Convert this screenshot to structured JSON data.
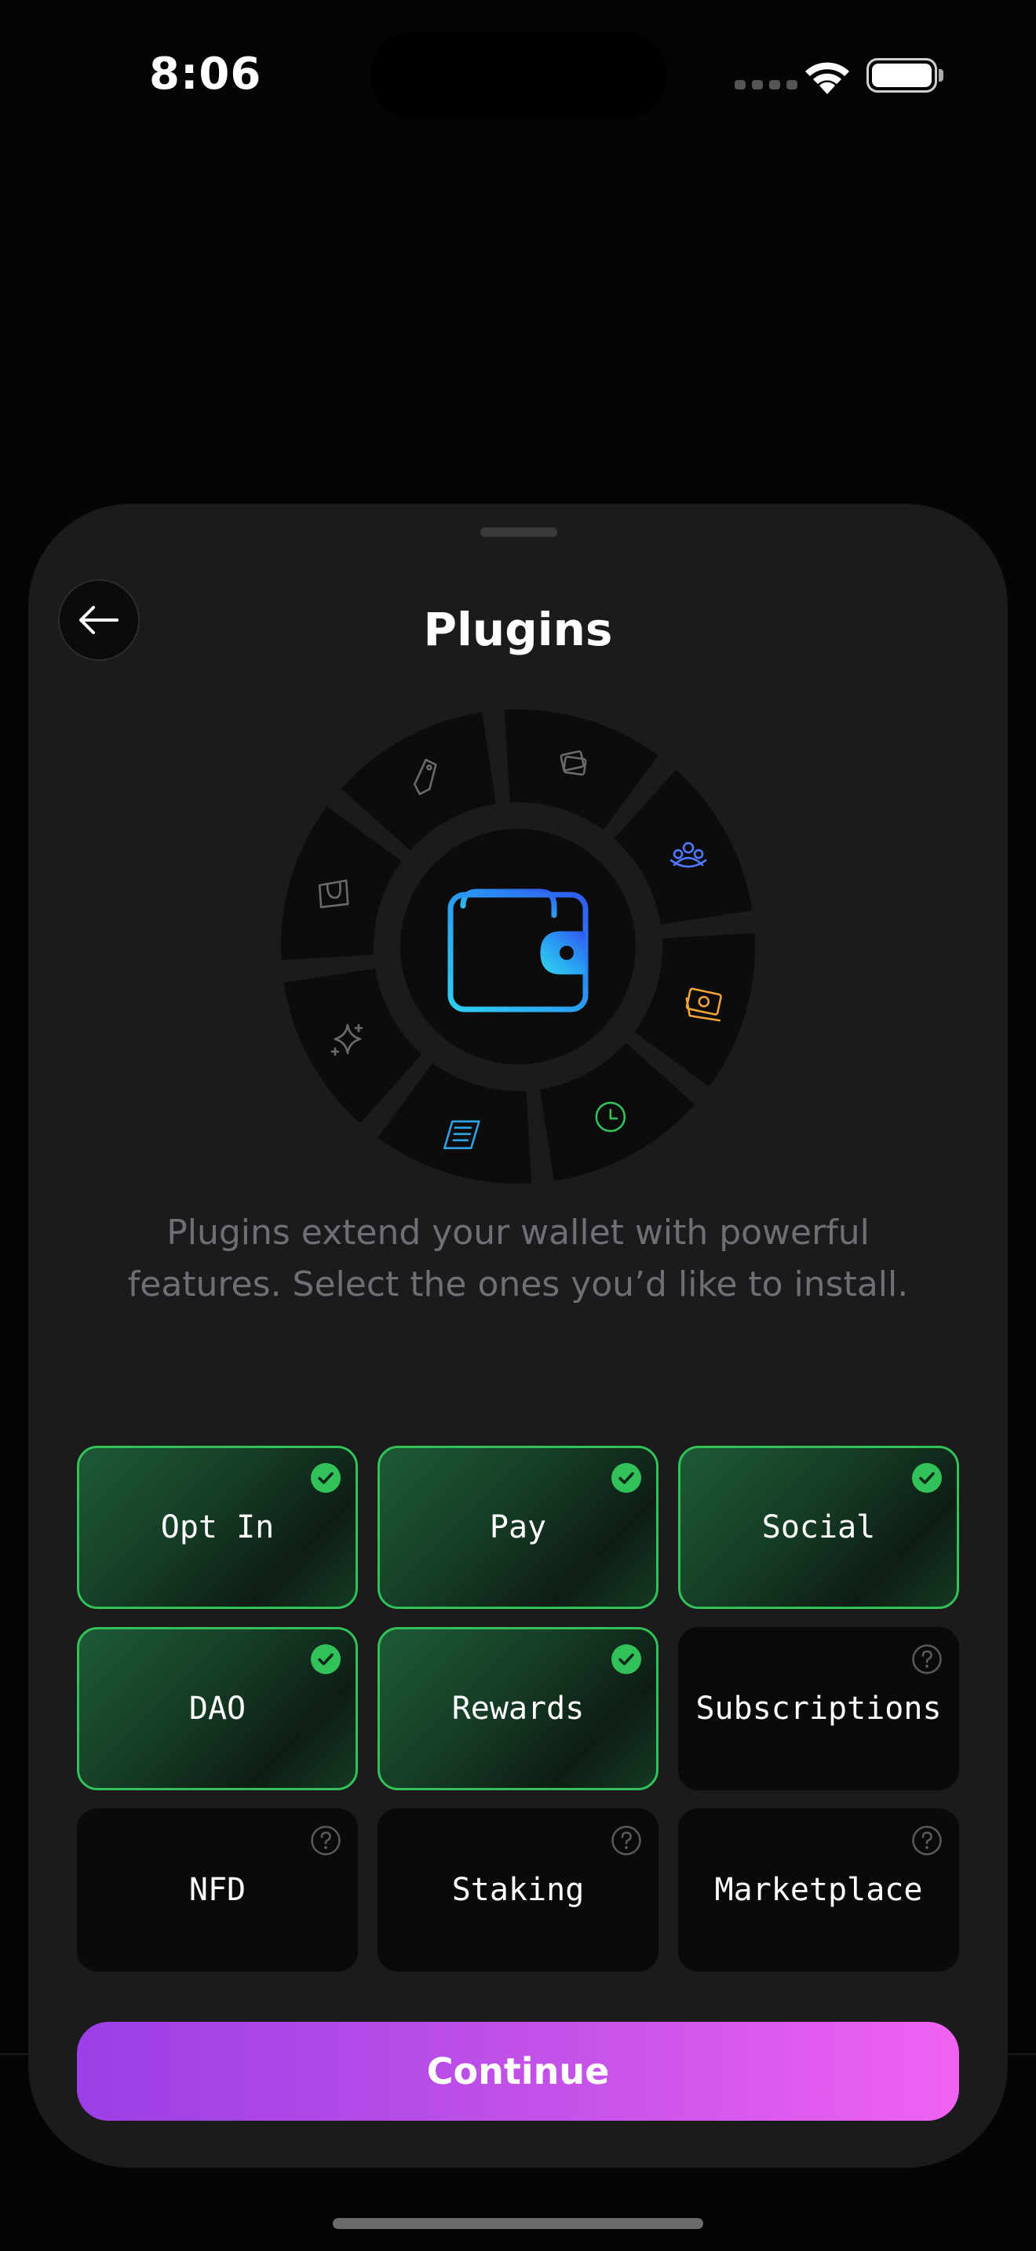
{
  "status_bar": {
    "time": "8:06"
  },
  "sheet": {
    "title": "Plugins",
    "description": "Plugins extend your wallet with powerful features. Select the ones you’d like to install.",
    "continue_label": "Continue"
  },
  "wheel": {
    "center_icon": "wallet-icon",
    "segments": [
      {
        "icon": "cards-icon",
        "color": "#6a6a6e"
      },
      {
        "icon": "community-icon",
        "color": "#4e79ff"
      },
      {
        "icon": "cash-icon",
        "color": "#f0a43a"
      },
      {
        "icon": "clock-icon",
        "color": "#33c25a"
      },
      {
        "icon": "receipt-icon",
        "color": "#2fa4e8"
      },
      {
        "icon": "sparkles-icon",
        "color": "#6a6a6e"
      },
      {
        "icon": "shopping-bag-icon",
        "color": "#6a6a6e"
      },
      {
        "icon": "tag-icon",
        "color": "#6a6a6e"
      }
    ]
  },
  "plugins": [
    {
      "label": "Opt In",
      "selected": true
    },
    {
      "label": "Pay",
      "selected": true
    },
    {
      "label": "Social",
      "selected": true
    },
    {
      "label": "DAO",
      "selected": true
    },
    {
      "label": "Rewards",
      "selected": true
    },
    {
      "label": "Subscriptions",
      "selected": false
    },
    {
      "label": "NFD",
      "selected": false
    },
    {
      "label": "Staking",
      "selected": false
    },
    {
      "label": "Marketplace",
      "selected": false
    }
  ],
  "colors": {
    "accent_green": "#33c25a",
    "button_gradient_start": "#9b3fe6",
    "button_gradient_end": "#f062f2",
    "sheet_background": "#1b1b1d"
  }
}
